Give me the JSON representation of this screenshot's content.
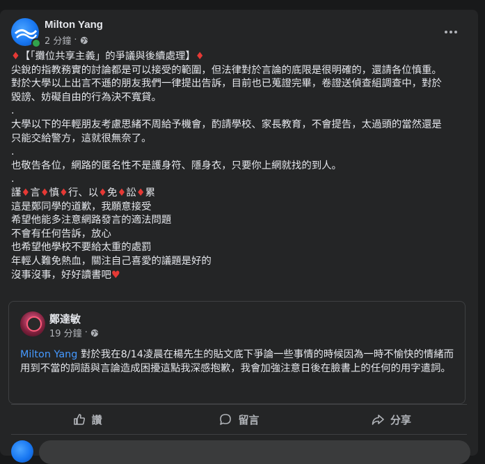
{
  "post": {
    "author": "Milton Yang",
    "time": "2 分鐘",
    "more_label": "更多選項"
  },
  "body_lines": [
    "【「攤位共享主義」的爭議與後續處理】",
    "尖銳的指教務實的討論都是可以接受的範圍，但法律對於言論的底限是很明確的，還請各位慎重。",
    "對於大學以上出言不遜的朋友我們一律提出告訴，目前也已蒐證完畢，卷證送偵查組調查中，對於",
    "毀謗、妨礙自由的行為決不寬貸。",
    ".",
    "大學以下的年輕朋友考慮思緒不周給予機會，酌請學校、家長教育，不會提告，太過頭的當然還是",
    "只能交給警方，這就很無奈了。",
    ".",
    "也敬告各位，網路的匿名性不是護身符、隱身衣，只要你上網就找的到人。",
    ".",
    "謹 言 慎 行、以 免 訟 累",
    "這是鄭同學的道歉，我願意接受",
    "希望他能多注意網路發言的適法問題",
    "不會有任何告訴，放心",
    "也希望他學校不要給太重的處罰",
    "年輕人難免熱血，關注自己喜愛的議題是好的",
    "沒事沒事，好好讀書吧"
  ],
  "motto_words": [
    "謹",
    "言",
    "慎",
    "行、以",
    "免",
    "訟",
    "累"
  ],
  "shared_post": {
    "author": "鄭達敏",
    "time": "19 分鐘",
    "mention": "Milton Yang",
    "text": " 對於我在8/14凌晨在楊先生的貼文底下爭論一些事情的時候因為一時不愉快的情緒而用到不當的詞語與言論造成困擾這點我深感抱歉，我會加強注意日後在臉書上的任何的用字遣詞。"
  },
  "actions": {
    "like": "讚",
    "comment": "留言",
    "share": "分享"
  },
  "colors": {
    "background": "#18191a",
    "card": "#242526",
    "text": "#e4e6eb",
    "muted": "#b0b3b8",
    "mention": "#4599ff",
    "diamond": "#e53935"
  }
}
